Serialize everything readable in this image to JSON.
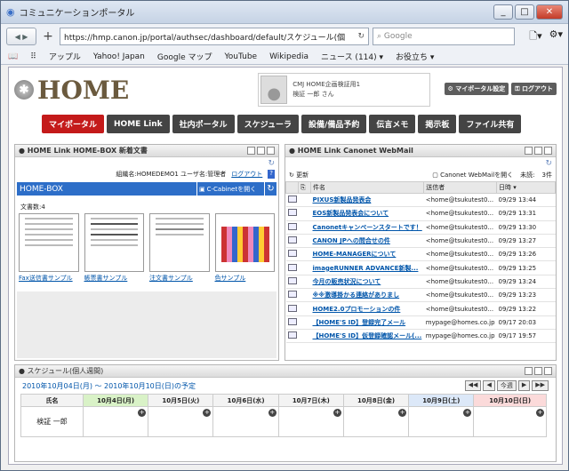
{
  "window": {
    "title": "コミュニケーションポータル"
  },
  "browser": {
    "url": "https://hmp.canon.jp/portal/authsec/dashboard/default/スケジュール(個",
    "search_placeholder": "Google"
  },
  "bookmarks": [
    "アップル",
    "Yahoo! Japan",
    "Google マップ",
    "YouTube",
    "Wikipedia",
    "ニュース (114) ▾",
    "お役立ち ▾"
  ],
  "header": {
    "logo": "HOME",
    "user_company": "CMJ HOME企画検証用1",
    "user_name": "検証 一郎 さん",
    "btn_settings": "マイポータル設定",
    "btn_logout": "ログアウト"
  },
  "tabs": [
    "マイポータル",
    "HOME Link",
    "社内ポータル",
    "スケジューラ",
    "設備/備品予約",
    "伝言メモ",
    "掲示板",
    "ファイル共有"
  ],
  "homebox": {
    "title": "HOME Link HOME-BOX 新着文書",
    "info": "組織名:HOMEDEMO1 ユーザ名:管理者",
    "logout": "ログアウト",
    "help": "?",
    "box": "HOME-BOX",
    "cabinet": "C-Cabinetを開く",
    "count": "文書数:4",
    "docs": [
      "Fax送信書サンプル",
      "帳票書サンプル",
      "注文書サンプル",
      "色サンプル"
    ]
  },
  "webmail": {
    "title": "HOME Link Canonet WebMail",
    "update": "更新",
    "open": "Canonet WebMailを開く",
    "unread": "未読:",
    "total": "3件",
    "cols": [
      "件名",
      "送信者",
      "日時 ▾"
    ],
    "rows": [
      [
        "PIXUS新製品発表会",
        "<home@tsukutest0...",
        "09/29 13:44"
      ],
      [
        "EOS新製品発表会について",
        "<home@tsukutest0...",
        "09/29 13:31"
      ],
      [
        "Canonetキャンペーンスタートです！",
        "<home@tsukutest0...",
        "09/29 13:30"
      ],
      [
        "CANON JPへの問合せの件",
        "<home@tsukutest0...",
        "09/29 13:27"
      ],
      [
        "HOME-MANAGERについて",
        "<home@tsukutest0...",
        "09/29 13:26"
      ],
      [
        "imageRUNNER ADVANCE新製...",
        "<home@tsukutest0...",
        "09/29 13:25"
      ],
      [
        "今月の販売状況について",
        "<home@tsukutest0...",
        "09/29 13:24"
      ],
      [
        "※※激導掛かる連絡がありまし",
        "<home@tsukutest0...",
        "09/29 13:23"
      ],
      [
        "HOME2.0プロモーションの件",
        "<home@tsukutest0...",
        "09/29 13:22"
      ],
      [
        "【HOME'S ID】登録完了メール",
        "mypage@homes.co.jp",
        "09/17 20:03"
      ],
      [
        "【HOME'S ID】仮登録確認メール(...",
        "mypage@homes.co.jp",
        "09/17 19:57"
      ]
    ]
  },
  "schedule": {
    "title": "スケジュール(個人週間)",
    "range": "2010年10月04日(月) ～ 2010年10月10日(日)の予定",
    "nav": [
      "◀◀",
      "◀",
      "今週",
      "▶",
      "▶▶"
    ],
    "name_header": "氏名",
    "person": "検証 一郎",
    "days": [
      "10月4日(月)",
      "10月5日(火)",
      "10月6日(水)",
      "10月7日(木)",
      "10月8日(金)",
      "10月9日(土)",
      "10月10日(日)"
    ]
  }
}
